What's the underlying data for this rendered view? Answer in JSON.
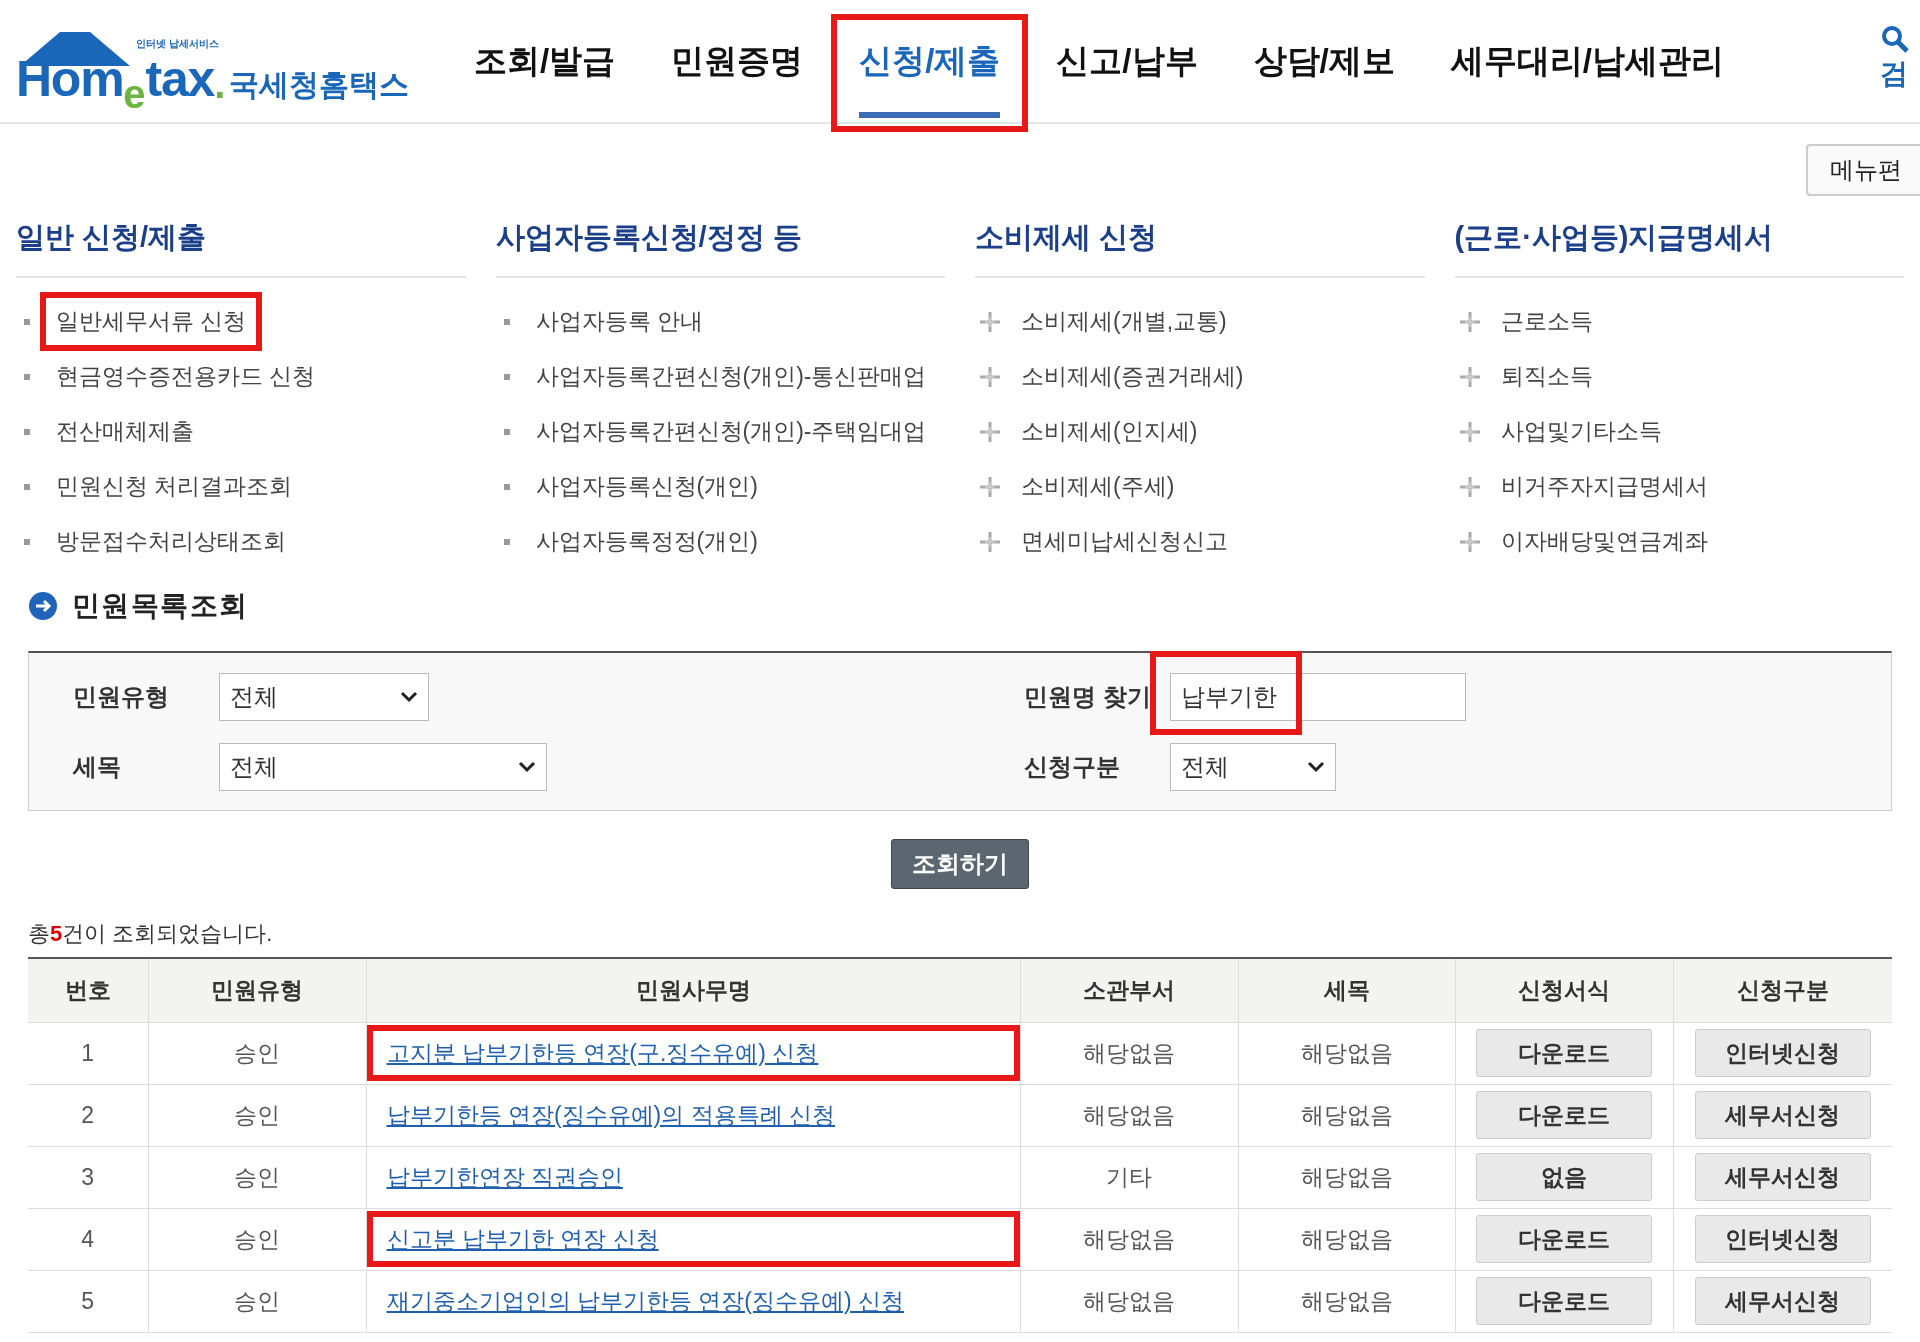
{
  "logo": {
    "tagline": "인터넷 납세서비스",
    "wordmark_left": "Hom",
    "wordmark_e": "e",
    "wordmark_right": "tax",
    "dot": ".",
    "korean": "국세청홈택스"
  },
  "nav": [
    {
      "label": "조회/발급",
      "selected": false,
      "highlighted": false
    },
    {
      "label": "민원증명",
      "selected": false,
      "highlighted": false
    },
    {
      "label": "신청/제출",
      "selected": true,
      "highlighted": true
    },
    {
      "label": "신고/납부",
      "selected": false,
      "highlighted": false
    },
    {
      "label": "상담/제보",
      "selected": false,
      "highlighted": false
    },
    {
      "label": "세무대리/납세관리",
      "selected": false,
      "highlighted": false
    }
  ],
  "search_label": "검",
  "menu_edit_button": "메뉴편",
  "menu_columns": [
    {
      "title": "일반 신청/제출",
      "kind": "square",
      "items": [
        {
          "label": "일반세무서류 신청",
          "highlighted": true
        },
        {
          "label": "현금영수증전용카드 신청",
          "highlighted": false
        },
        {
          "label": "전산매체제출",
          "highlighted": false
        },
        {
          "label": "민원신청 처리결과조회",
          "highlighted": false
        },
        {
          "label": "방문접수처리상태조회",
          "highlighted": false
        }
      ]
    },
    {
      "title": "사업자등록신청/정정 등",
      "kind": "square",
      "items": [
        {
          "label": "사업자등록 안내",
          "highlighted": false
        },
        {
          "label": "사업자등록간편신청(개인)-통신판매업",
          "highlighted": false
        },
        {
          "label": "사업자등록간편신청(개인)-주택임대업",
          "highlighted": false
        },
        {
          "label": "사업자등록신청(개인)",
          "highlighted": false
        },
        {
          "label": "사업자등록정정(개인)",
          "highlighted": false
        }
      ]
    },
    {
      "title": "소비제세 신청",
      "kind": "plus",
      "items": [
        {
          "label": "소비제세(개별,교통)",
          "highlighted": false
        },
        {
          "label": "소비제세(증권거래세)",
          "highlighted": false
        },
        {
          "label": "소비제세(인지세)",
          "highlighted": false
        },
        {
          "label": "소비제세(주세)",
          "highlighted": false
        },
        {
          "label": "면세미납세신청신고",
          "highlighted": false
        }
      ]
    },
    {
      "title": "(근로·사업등)지급명세서",
      "kind": "plus",
      "items": [
        {
          "label": "근로소득",
          "highlighted": false
        },
        {
          "label": "퇴직소득",
          "highlighted": false
        },
        {
          "label": "사업및기타소득",
          "highlighted": false
        },
        {
          "label": "비거주자지급명세서",
          "highlighted": false
        },
        {
          "label": "이자배당및연금계좌",
          "highlighted": false
        }
      ]
    }
  ],
  "section_title": "민원목록조회",
  "filters": [
    {
      "label": "민원유형",
      "kind": "select",
      "value": "전체",
      "highlighted": false
    },
    {
      "label": "민원명 찾기",
      "kind": "input",
      "value": "납부기한",
      "highlighted": true
    },
    {
      "label": "세목",
      "kind": "select",
      "value": "전체",
      "highlighted": false
    },
    {
      "label": "신청구분",
      "kind": "select",
      "value": "전체",
      "highlighted": false
    }
  ],
  "search_button": "조회하기",
  "result_summary": "총**5**건이 조회되었습니다.",
  "table": {
    "columns": [
      "번호",
      "민원유형",
      "민원사무명",
      "소관부서",
      "세목",
      "신청서식",
      "신청구분"
    ],
    "rows": [
      {
        "no": "1",
        "type": "승인",
        "name": "고지분 납부기한등 연장(구.징수유예) 신청",
        "dept": "해당없음",
        "tax": "해당없음",
        "form": "다운로드",
        "apply": "인터넷신청",
        "highlighted": true
      },
      {
        "no": "2",
        "type": "승인",
        "name": "납부기한등 연장(징수유예)의 적용특례 신청",
        "dept": "해당없음",
        "tax": "해당없음",
        "form": "다운로드",
        "apply": "세무서신청",
        "highlighted": false
      },
      {
        "no": "3",
        "type": "승인",
        "name": "납부기한연장 직권승인",
        "dept": "기타",
        "tax": "해당없음",
        "form": "없음",
        "apply": "세무서신청",
        "highlighted": false
      },
      {
        "no": "4",
        "type": "승인",
        "name": "신고분 납부기한 연장 신청",
        "dept": "해당없음",
        "tax": "해당없음",
        "form": "다운로드",
        "apply": "인터넷신청",
        "highlighted": true
      },
      {
        "no": "5",
        "type": "승인",
        "name": "재기중소기업인의 납부기한등 연장(징수유예) 신청",
        "dept": "해당없음",
        "tax": "해당없음",
        "form": "다운로드",
        "apply": "세무서신청",
        "highlighted": false
      }
    ]
  }
}
